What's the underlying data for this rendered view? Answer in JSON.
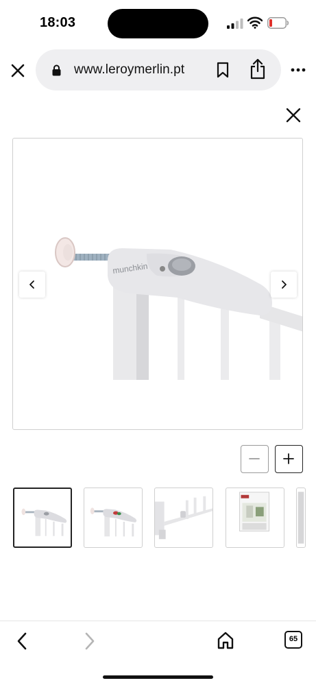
{
  "status_bar": {
    "time": "18:03",
    "icons": [
      "signal-icon",
      "wifi-icon",
      "battery-icon"
    ],
    "battery_color": "#e0312b"
  },
  "browser": {
    "url": "www.leroymerlin.pt",
    "icons": [
      "close-icon",
      "lock-icon",
      "bookmark-icon",
      "share-icon",
      "more-icon"
    ]
  },
  "viewer": {
    "close_icon": "close-icon",
    "image_brand_text": "munchkin",
    "prev_icon": "chevron-left-icon",
    "next_icon": "chevron-right-icon",
    "zoom_out_icon": "minus-icon",
    "zoom_in_icon": "plus-icon",
    "thumbnails": [
      {
        "name": "thumbnail-1",
        "active": true
      },
      {
        "name": "thumbnail-2",
        "active": false
      },
      {
        "name": "thumbnail-3",
        "active": false
      },
      {
        "name": "thumbnail-4",
        "active": false
      },
      {
        "name": "thumbnail-5",
        "active": false
      }
    ]
  },
  "toolbar": {
    "icons": [
      "back-icon",
      "forward-icon",
      "home-icon",
      "tabs-icon"
    ],
    "tab_count": "65"
  }
}
